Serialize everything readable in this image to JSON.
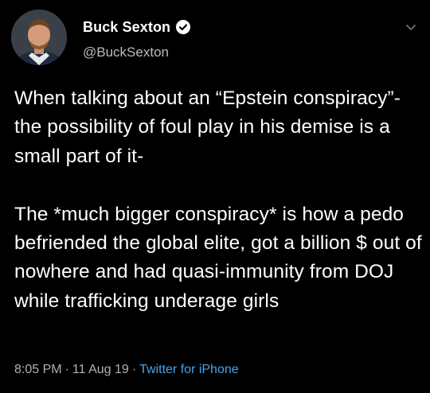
{
  "author": {
    "display_name": "Buck Sexton",
    "handle": "@BuckSexton",
    "verified": true,
    "avatar_icon": "profile-photo"
  },
  "tweet": {
    "text": "When talking about an “Epstein conspiracy”- the possibility of foul play in his demise is a small part of it-\n\nThe *much bigger conspiracy* is how a pedo befriended the global elite, got a billion $ out of nowhere and had quasi-immunity from DOJ while trafficking underage girls"
  },
  "meta": {
    "time": "8:05 PM",
    "date": "11 Aug 19",
    "source": "Twitter for iPhone",
    "separator": "·"
  },
  "colors": {
    "background": "#000000",
    "text": "#ffffff",
    "secondary": "#aeb3b8",
    "link": "#4aa3e8"
  },
  "icons": {
    "verified": "verified-badge-icon",
    "menu": "chevron-down-icon"
  }
}
